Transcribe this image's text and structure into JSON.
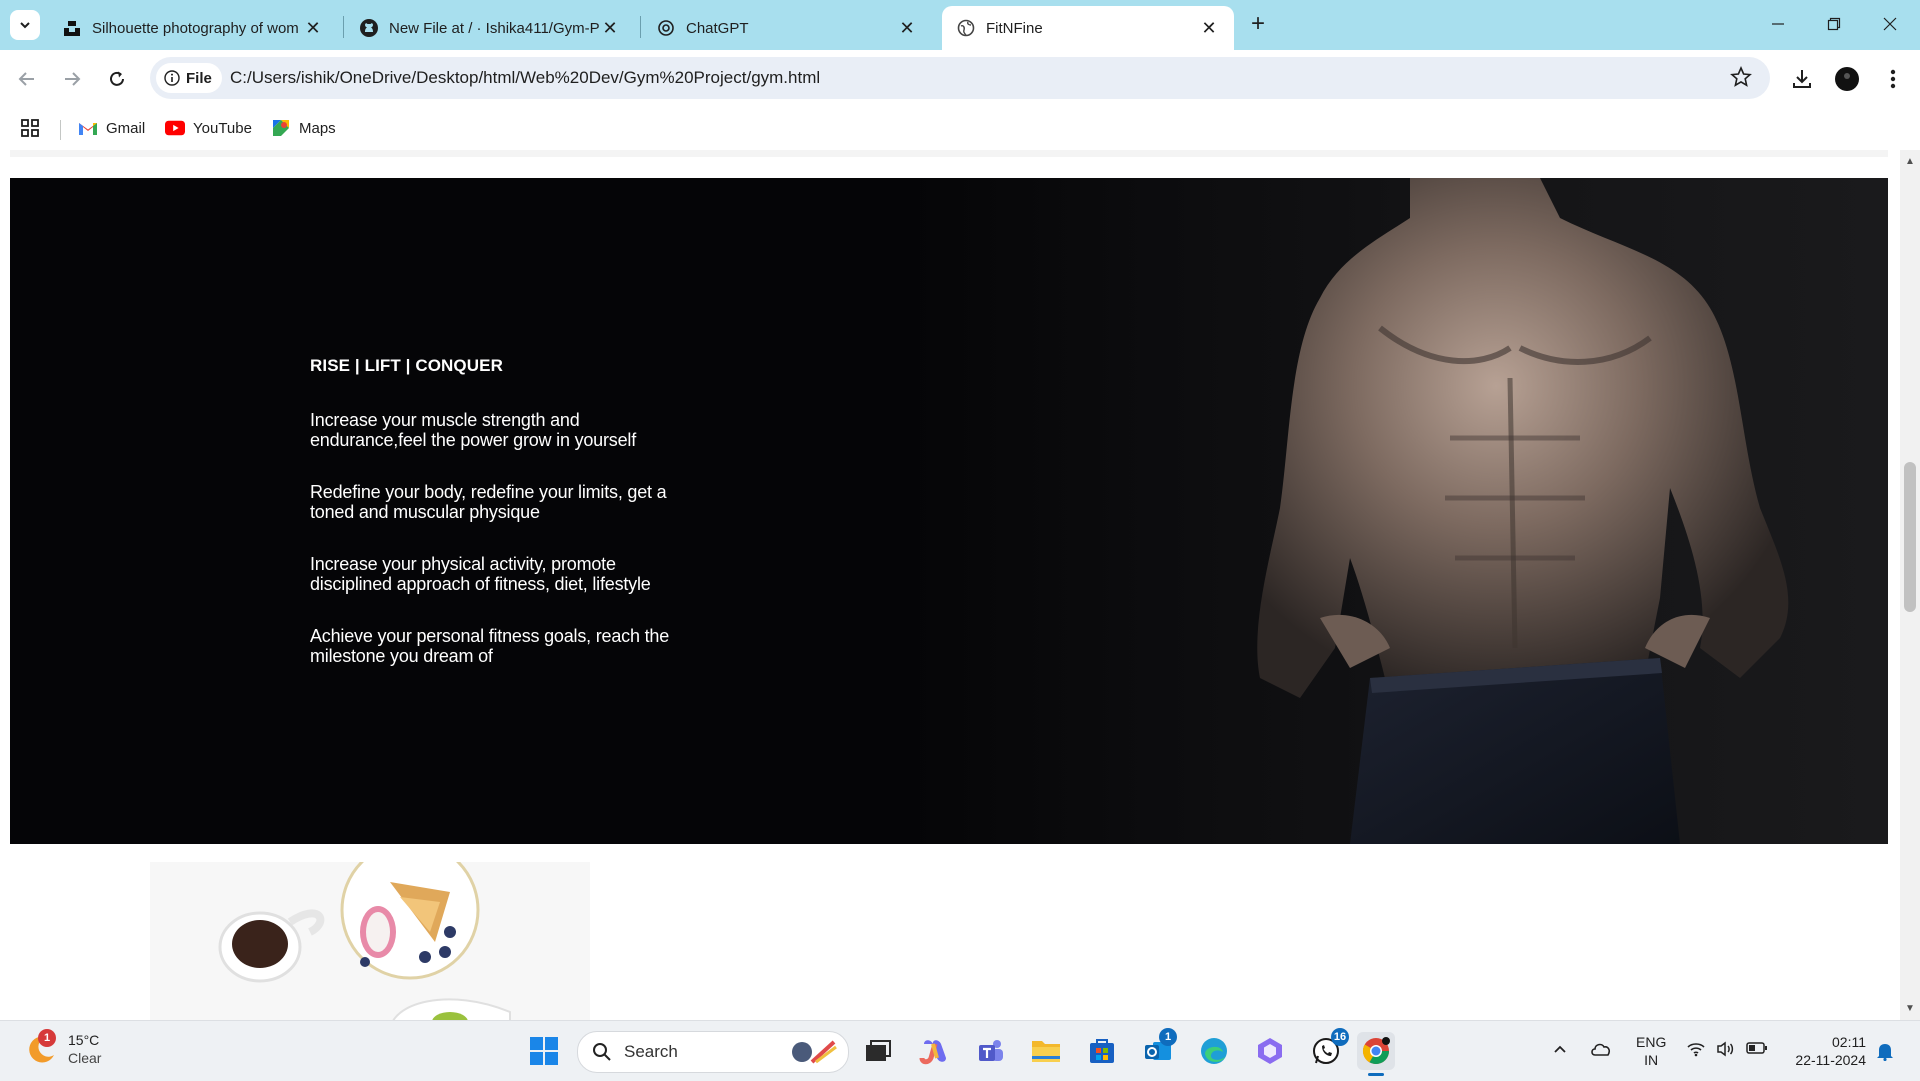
{
  "browser": {
    "tabs": [
      {
        "title": "Silhouette photography of wom",
        "icon": "unsplash-icon",
        "active": false
      },
      {
        "title": "New File at / · Ishika411/Gym-P",
        "icon": "github-icon",
        "active": false
      },
      {
        "title": "ChatGPT",
        "icon": "chatgpt-icon",
        "active": false
      },
      {
        "title": "FitNFine",
        "icon": "globe-icon",
        "active": true
      }
    ],
    "new_tab_label": "+",
    "address": {
      "scheme_chip": "File",
      "url": "C:/Users/ishik/OneDrive/Desktop/html/Web%20Dev/Gym%20Project/gym.html"
    },
    "bookmarks": [
      {
        "label": "Gmail",
        "icon": "gmail-icon"
      },
      {
        "label": "YouTube",
        "icon": "youtube-icon"
      },
      {
        "label": "Maps",
        "icon": "maps-icon"
      }
    ]
  },
  "page": {
    "hero": {
      "heading": "RISE | LIFT | CONQUER",
      "paragraphs": [
        "Increase your muscle strength and endurance,feel the power grow in yourself",
        "Redefine your body, redefine your limits, get a toned and muscular physique",
        "Increase your physical activity, promote disciplined approach of fitness, diet, lifestyle",
        "Achieve your personal fitness goals, reach the milestone you dream of"
      ]
    }
  },
  "taskbar": {
    "weather": {
      "temp": "15°C",
      "condition": "Clear",
      "badge": "1"
    },
    "search_placeholder": "Search",
    "badges": {
      "outlook": "1",
      "whatsapp": "16"
    },
    "language": {
      "line1": "ENG",
      "line2": "IN"
    },
    "clock": {
      "time": "02:11",
      "date": "22-11-2024"
    }
  },
  "colors": {
    "tabstrip": "#a8dfee",
    "hero_bg": "#050507",
    "taskbar": "#eef1f4"
  }
}
